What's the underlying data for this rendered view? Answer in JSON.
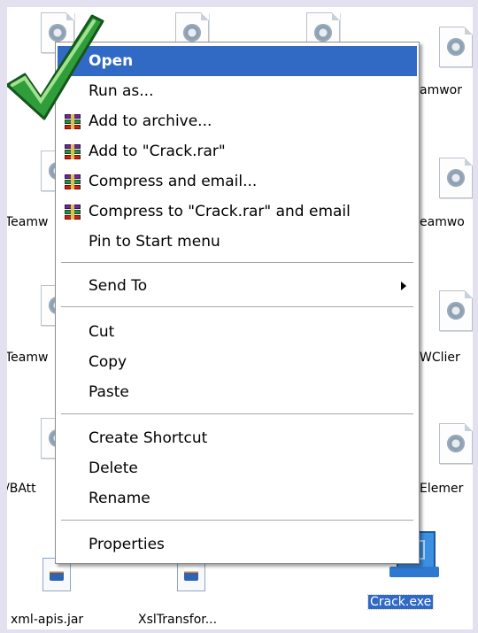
{
  "desktop": {
    "row1_left_fragment": "...",
    "row1_right_fragment": "amwor",
    "row2_left_fragment": "Teamw",
    "row2_right_fragment": "eamwo",
    "row3_left_fragment": "Teamw",
    "row3_right_fragment": "WClier",
    "row4_left_fragment": "/BAtt",
    "row4_right_fragment": "Elemer",
    "bottom_files": [
      {
        "label": "xml-apis.jar",
        "icon": "java-jar-icon"
      },
      {
        "label": "XslTransfor...",
        "icon": "java-jar-icon"
      }
    ],
    "selected_file": {
      "label": "Crack.exe",
      "icon": "application-exe-icon"
    }
  },
  "context_menu": {
    "items": [
      {
        "label": "Open",
        "icon": null,
        "highlight": true
      },
      {
        "label": "Run as...",
        "icon": null
      },
      {
        "label": "Add to archive...",
        "icon": "winrar-icon"
      },
      {
        "label": "Add to \"Crack.rar\"",
        "icon": "winrar-icon"
      },
      {
        "label": "Compress and email...",
        "icon": "winrar-icon"
      },
      {
        "label": "Compress to \"Crack.rar\" and email",
        "icon": "winrar-icon"
      },
      {
        "label": "Pin to Start menu",
        "icon": null
      },
      {
        "label": "Send To",
        "icon": null,
        "submenu": true
      },
      {
        "label": "Cut",
        "icon": null
      },
      {
        "label": "Copy",
        "icon": null
      },
      {
        "label": "Paste",
        "icon": null
      },
      {
        "label": "Create Shortcut",
        "icon": null
      },
      {
        "label": "Delete",
        "icon": null
      },
      {
        "label": "Rename",
        "icon": null
      },
      {
        "label": "Properties",
        "icon": null
      }
    ]
  },
  "colors": {
    "highlight": "#316ac5",
    "frame": "#e3e1f0",
    "checkmark_green": "#2f9e3a"
  }
}
